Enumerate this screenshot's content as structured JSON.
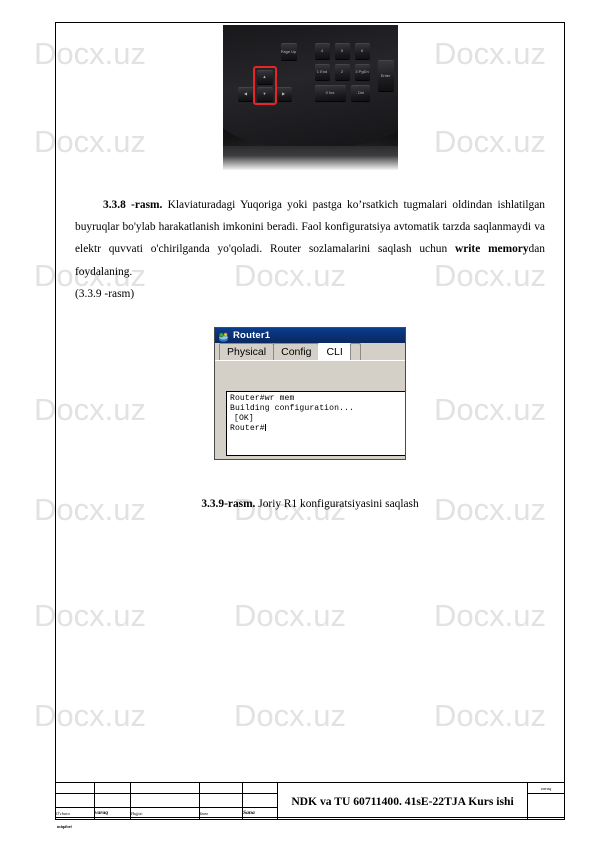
{
  "document": {
    "watermark_text": "Docx.uz",
    "watermark_color": "#e2e2e2"
  },
  "figure_keyboard": {
    "name": "keyboard-photo",
    "highlight_color": "#e8232a",
    "keys": [
      {
        "label": "Page\nUp"
      },
      {
        "label": "4"
      },
      {
        "label": "5"
      },
      {
        "label": "6"
      },
      {
        "label": "1\nEnd"
      },
      {
        "label": "2"
      },
      {
        "label": "3\nPgDn"
      },
      {
        "label": "0\nIns"
      },
      {
        "label": ".\nDel"
      },
      {
        "label": "Enter"
      }
    ]
  },
  "paragraph": {
    "figure_label": "3.3.8 -rasm.",
    "text_1": " Klaviaturadagi Yuqoriga yoki pastga ko’rsatkich  tugmalari oldindan ishlatilgan buyruqlar bo'ylab harakatlanish imkonini beradi. Faol konfiguratsiya avtomatik tarzda saqlanmaydi va elektr quvvati o'chirilganda yo'qoladi. Router sozlamalarini saqlash uchun ",
    "bold_command": "write memory",
    "text_2": "dan foydalaning.",
    "figure_reference": "(3.3.9 -rasm)"
  },
  "router_dialog": {
    "title": "Router1",
    "title_icon": "router-device-icon",
    "tabs": [
      {
        "label": "Physical",
        "active": false
      },
      {
        "label": "Config",
        "active": false
      },
      {
        "label": "CLI",
        "active": true
      }
    ],
    "cli_lines": [
      {
        "text": "Router#wr mem",
        "indented": false
      },
      {
        "text": "Building configuration...",
        "indented": false
      },
      {
        "text": "[OK]",
        "indented": true
      },
      {
        "text": "Router#",
        "indented": false
      }
    ]
  },
  "caption": {
    "label": "3.3.9-rasm.",
    "text": " Joriy R1 konfiguratsiyasini saqlash"
  },
  "footer": {
    "labels": {
      "ozgar": "O'chara",
      "ozgar_line2": "miqdori",
      "varaq": "varaq",
      "hujjat": "Hujjat:",
      "imzo": "Imzo",
      "sana": "Sana"
    },
    "main_text": "NDK va TU  60711400. 41sE-22TJA Kurs ishi",
    "varaq_label": "varaq"
  }
}
